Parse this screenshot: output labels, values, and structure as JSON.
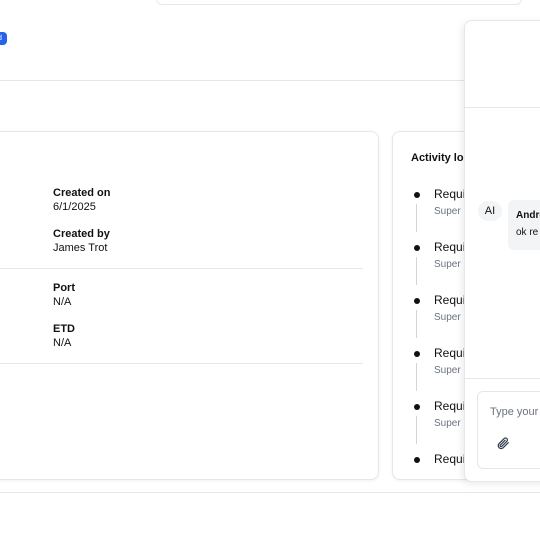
{
  "status_badge": {
    "label": "d"
  },
  "details": {
    "created_on": {
      "label": "Created on",
      "value": "6/1/2025"
    },
    "created_by": {
      "label": "Created by",
      "value": "James Trot"
    },
    "port": {
      "label": "Port",
      "value": "N/A"
    },
    "etd": {
      "label": "ETD",
      "value": "N/A"
    }
  },
  "activity": {
    "title": "Activity log",
    "items": [
      {
        "title": "Requi",
        "subtitle": "Super"
      },
      {
        "title": "Requi",
        "subtitle": "Super"
      },
      {
        "title": "Requi",
        "subtitle": "Super"
      },
      {
        "title": "Requi",
        "subtitle": "Super"
      },
      {
        "title": "Requi",
        "subtitle": "Super"
      },
      {
        "title": "Requi",
        "subtitle": ""
      }
    ]
  },
  "chat": {
    "avatar": "AI",
    "sender": "Andre",
    "message": "ok re",
    "input_placeholder": "Type your",
    "attach_icon": "paperclip-icon"
  }
}
